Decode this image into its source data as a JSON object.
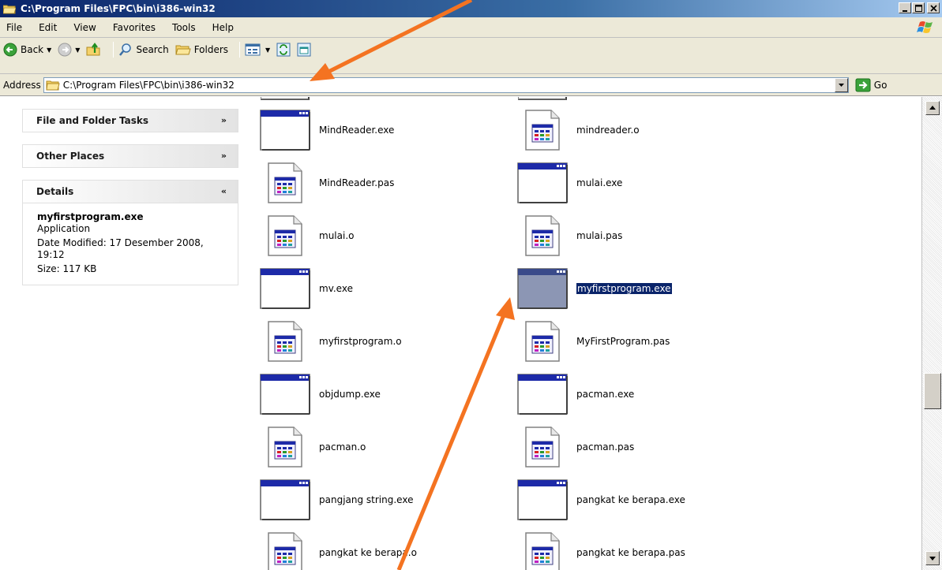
{
  "window": {
    "title": "C:\\Program Files\\FPC\\bin\\i386-win32"
  },
  "menu": [
    "File",
    "Edit",
    "View",
    "Favorites",
    "Tools",
    "Help"
  ],
  "toolbar": {
    "back_label": "Back",
    "search_label": "Search",
    "folders_label": "Folders"
  },
  "address": {
    "label": "Address",
    "value": "C:\\Program Files\\FPC\\bin\\i386-win32",
    "go_label": "Go"
  },
  "tasks": {
    "file_folder": "File and Folder Tasks",
    "other_places": "Other Places",
    "details": "Details"
  },
  "details": {
    "name": "myfirstprogram.exe",
    "type": "Application",
    "modified": "Date Modified: 17 Desember 2008, 19:12",
    "size": "Size: 117 KB"
  },
  "files": [
    {
      "name": "MindReader.exe",
      "kind": "exe"
    },
    {
      "name": "mindreader.o",
      "kind": "doc"
    },
    {
      "name": "MindReader.pas",
      "kind": "doc"
    },
    {
      "name": "mulai.exe",
      "kind": "exe"
    },
    {
      "name": "mulai.o",
      "kind": "doc"
    },
    {
      "name": "mulai.pas",
      "kind": "doc"
    },
    {
      "name": "mv.exe",
      "kind": "exe"
    },
    {
      "name": "myfirstprogram.exe",
      "kind": "exe",
      "selected": true
    },
    {
      "name": "myfirstprogram.o",
      "kind": "doc"
    },
    {
      "name": "MyFirstProgram.pas",
      "kind": "doc"
    },
    {
      "name": "objdump.exe",
      "kind": "exe"
    },
    {
      "name": "pacman.exe",
      "kind": "exe"
    },
    {
      "name": "pacman.o",
      "kind": "doc"
    },
    {
      "name": "pacman.pas",
      "kind": "doc"
    },
    {
      "name": "pangjang string.exe",
      "kind": "exe"
    },
    {
      "name": "pangkat ke berapa.exe",
      "kind": "exe"
    },
    {
      "name": "pangkat ke berapa.o",
      "kind": "doc"
    },
    {
      "name": "pangkat ke berapa.pas",
      "kind": "doc"
    }
  ],
  "colors": {
    "selection": "#0a246a",
    "annotation_arrow": "#f47321",
    "titlebar": "#0a246a"
  }
}
